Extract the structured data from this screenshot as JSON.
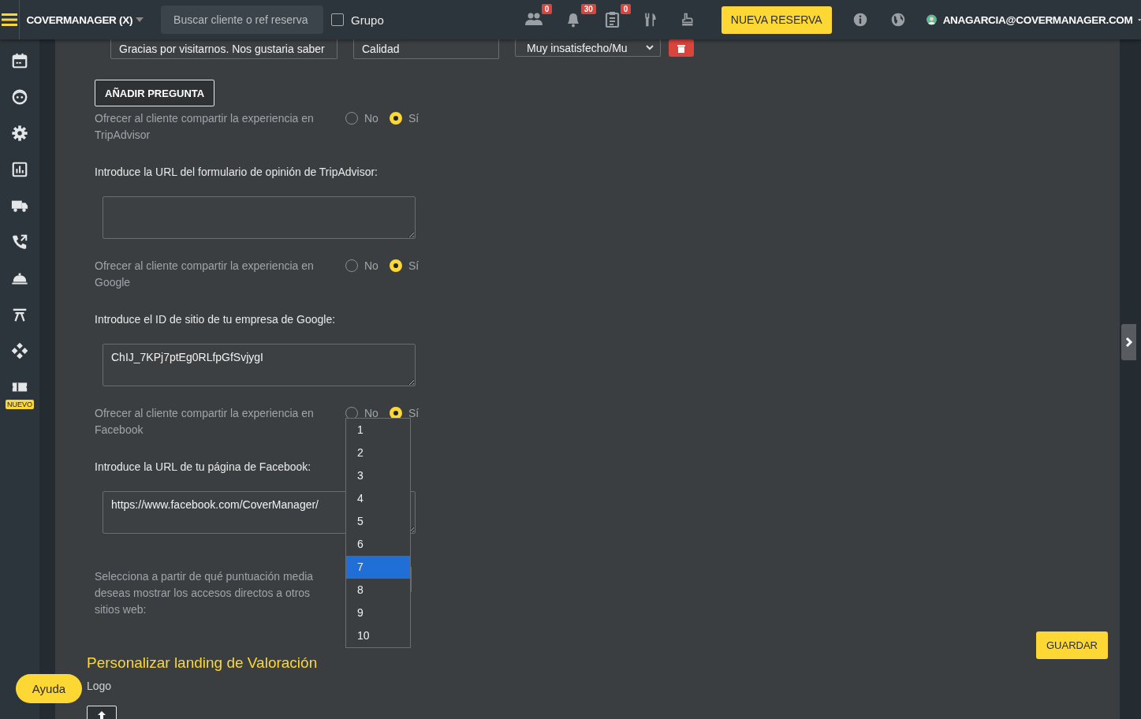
{
  "topbar": {
    "brand": "COVERMANAGER (X)",
    "search": {
      "placeholder": "Buscar cliente o ref reserva"
    },
    "group_checkbox": {
      "label": "Grupo",
      "checked": false
    },
    "notifications": [
      {
        "badge": "0"
      },
      {
        "badge": "30"
      },
      {
        "badge": "0"
      }
    ],
    "new_booking_button": "NUEVA RESERVA",
    "user": "ANAGARCIA@COVERMANAGER.COM"
  },
  "sidebar": {
    "new_badge": "NUEVO"
  },
  "question_row": {
    "text": "Gracias por visitarnos. Nos gustaria saber",
    "category": "Calidad",
    "scale": "Muy insatisfecho/Mu"
  },
  "add_question_button": "AÑADIR PREGUNTA",
  "share_options": [
    {
      "label": "Ofrecer al cliente compartir la experiencia en TripAdvisor",
      "options": [
        {
          "label": "No",
          "selected": false
        },
        {
          "label": "Sí",
          "selected": true
        }
      ],
      "field_label": "Introduce la URL del formulario de opinión de TripAdvisor:"
    },
    {
      "label": "Ofrecer al cliente compartir la experiencia en Google",
      "options": [
        {
          "label": "No",
          "selected": false
        },
        {
          "label": "Sí",
          "selected": true
        }
      ],
      "field_label": "Introduce el ID de sitio de tu empresa de Google:",
      "field_value": "ChIJ_7KPj7ptEg0RLfpGfSvjygI"
    },
    {
      "label": "Ofrecer al cliente compartir la experiencia en Facebook",
      "options": [
        {
          "label": "No",
          "selected": false
        },
        {
          "label": "Sí",
          "selected": true
        }
      ],
      "field_label": "Introduce la URL de tu página de Facebook:",
      "field_value": "https://www.facebook.com/CoverManager/"
    }
  ],
  "score": {
    "label": "Selecciona a partir de qué puntuación media deseas mostrar los accesos directos a otros sitios web:",
    "options": [
      {
        "label": "1",
        "selected": false
      },
      {
        "label": "2",
        "selected": false
      },
      {
        "label": "3",
        "selected": false
      },
      {
        "label": "4",
        "selected": false
      },
      {
        "label": "5",
        "selected": false
      },
      {
        "label": "6",
        "selected": false
      },
      {
        "label": "7",
        "selected": true
      },
      {
        "label": "8",
        "selected": false
      },
      {
        "label": "9",
        "selected": false
      },
      {
        "label": "10",
        "selected": false
      }
    ]
  },
  "save_button": "GUARDAR",
  "landing": {
    "title": "Personalizar landing de Valoración",
    "logo_label": "Logo"
  },
  "help_button": "Ayuda"
}
